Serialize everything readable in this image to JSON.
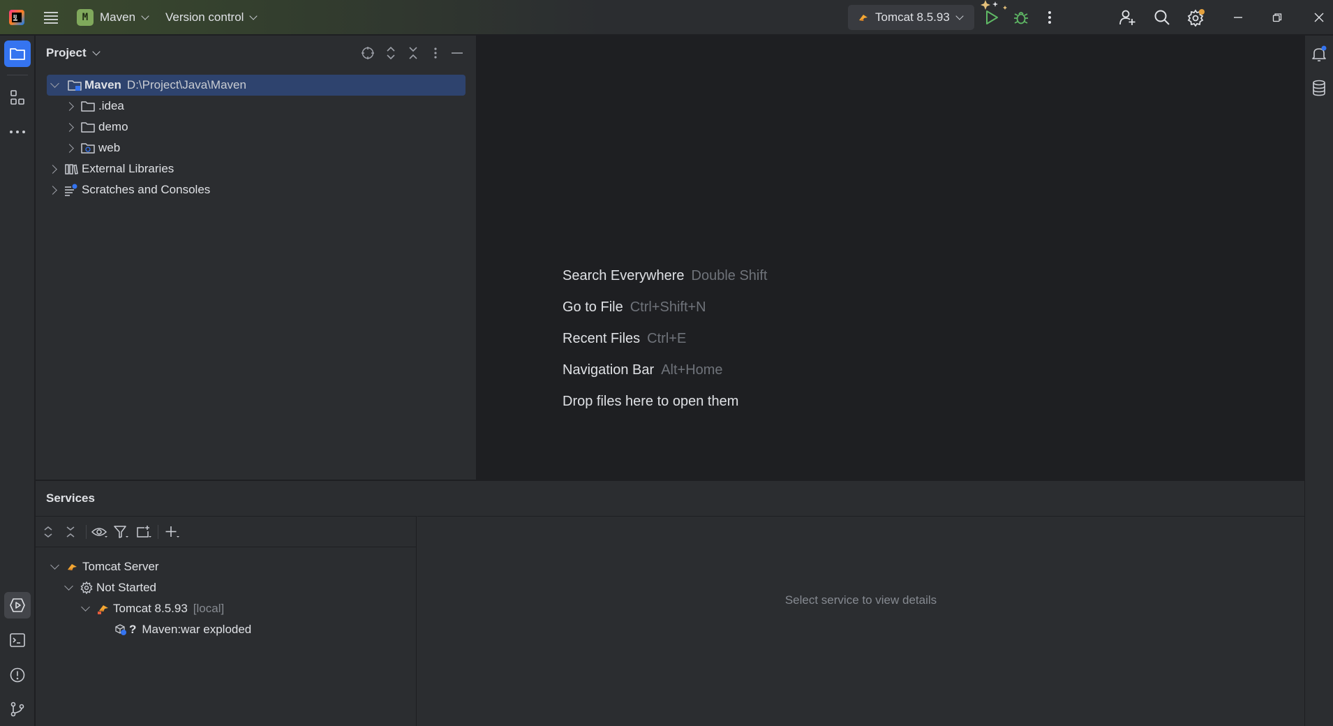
{
  "titlebar": {
    "project_badge": "M",
    "project_name": "Maven",
    "vcs_label": "Version control",
    "run_config": "Tomcat 8.5.93",
    "icons": [
      "intellij-logo-icon",
      "main-menu-icon",
      "run-icon",
      "debug-icon",
      "more-icon",
      "code-with-me-icon",
      "search-icon",
      "settings-icon",
      "minimize-icon",
      "restore-icon",
      "close-icon"
    ],
    "accent": "#3574f0",
    "run_color": "#5fb865"
  },
  "left_stripe": {
    "icons": [
      "project-folder-icon",
      "structure-icon",
      "more-tools-icon",
      "services-icon",
      "terminal-icon",
      "problems-icon",
      "git-icon"
    ]
  },
  "right_stripe": {
    "icons": [
      "notifications-icon",
      "database-icon"
    ]
  },
  "project_panel": {
    "title": "Project",
    "toolbar_icons": [
      "locate-icon",
      "expand-all-icon",
      "collapse-all-icon",
      "options-icon",
      "hide-icon"
    ],
    "tree": {
      "root_name": "Maven",
      "root_path": "D:\\Project\\Java\\Maven",
      "children": [
        ".idea",
        "demo",
        "web"
      ],
      "external_libraries": "External Libraries",
      "scratches": "Scratches and Consoles"
    }
  },
  "editor": {
    "hints": [
      {
        "action": "Search Everywhere",
        "shortcut": "Double Shift"
      },
      {
        "action": "Go to File",
        "shortcut": "Ctrl+Shift+N"
      },
      {
        "action": "Recent Files",
        "shortcut": "Ctrl+E"
      },
      {
        "action": "Navigation Bar",
        "shortcut": "Alt+Home"
      },
      {
        "action": "Drop files here to open them",
        "shortcut": ""
      }
    ]
  },
  "services": {
    "title": "Services",
    "toolbar_icons": [
      "expand-all-icon",
      "collapse-all-icon",
      "view-options-icon",
      "filter-icon",
      "new-tab-icon",
      "add-service-icon"
    ],
    "tree": {
      "server_group": "Tomcat Server",
      "state_group": "Not Started",
      "server_name": "Tomcat 8.5.93",
      "server_suffix": "[local]",
      "artifact_status": "?",
      "artifact": "Maven:war exploded"
    },
    "empty_message": "Select service to view details"
  }
}
